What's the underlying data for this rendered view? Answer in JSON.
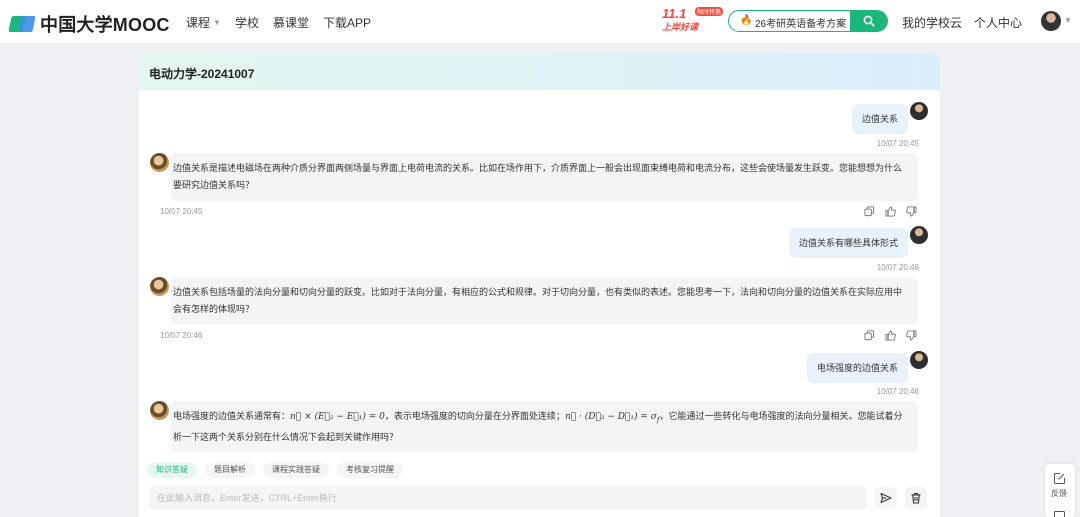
{
  "brand": {
    "name": "中国大学MOOC"
  },
  "nav": [
    {
      "label": "课程",
      "has_caret": true
    },
    {
      "label": "学校"
    },
    {
      "label": "慕课堂"
    },
    {
      "label": "下载APP"
    }
  ],
  "promo": {
    "big": "11.1",
    "tag": "限时特惠",
    "sub": "上岸好课"
  },
  "search": {
    "text": "26考研英语备考方案"
  },
  "header_links": {
    "school_cloud": "我的学校云",
    "personal_center": "个人中心"
  },
  "chat": {
    "title": "电动力学-20241007",
    "messages": [
      {
        "role": "user",
        "text": "边值关系",
        "time": "10/07 20:45"
      },
      {
        "role": "assistant",
        "text": "边值关系是描述电磁场在两种介质分界面两侧场量与界面上电荷电流的关系。比如在场作用下，介质界面上一般会出现面束缚电荷和电流分布，这些会使场量发生跃变。您能想想为什么要研究边值关系吗？",
        "time": "10/07 20:45"
      },
      {
        "role": "user",
        "text": "边值关系有哪些具体形式",
        "time": "10/07 20:46"
      },
      {
        "role": "assistant",
        "text": "边值关系包括场量的法向分量和切向分量的跃变。比如对于法向分量，有相应的公式和规律。对于切向分量，也有类似的表述。您能思考一下，法向和切向分量的边值关系在实际应用中会有怎样的体现吗？",
        "time": "10/07 20:46"
      },
      {
        "role": "user",
        "text": "电场强度的边值关系",
        "time": "10/07 20:46"
      },
      {
        "role": "assistant",
        "text_parts": [
          "电场强度的边值关系通常有：",
          "n⃗ × (E⃗₂ − E⃗₁) = 0",
          "，表示电场强度的切向分量在分界面处连续；",
          "n⃗ · (D⃗₂ − D⃗₁) = σ",
          "f",
          "，它能通过一些转化与电场强度的法向分量相关。您能试着分析一下这两个关系分别在什么情况下会起到关键作用吗？"
        ]
      }
    ]
  },
  "tools": [
    "知识答疑",
    "题目解析",
    "课程实践答疑",
    "考核复习提醒"
  ],
  "input": {
    "placeholder": "在此输入消息，Enter发送，CTRL+Enter换行",
    "value": ""
  },
  "feedback": {
    "label": "反馈"
  },
  "colors": {
    "accent": "#1bb77a",
    "user_bubble": "#e9f1fb",
    "bot_bubble": "#f3f4f6",
    "promo": "#f24b3c"
  }
}
